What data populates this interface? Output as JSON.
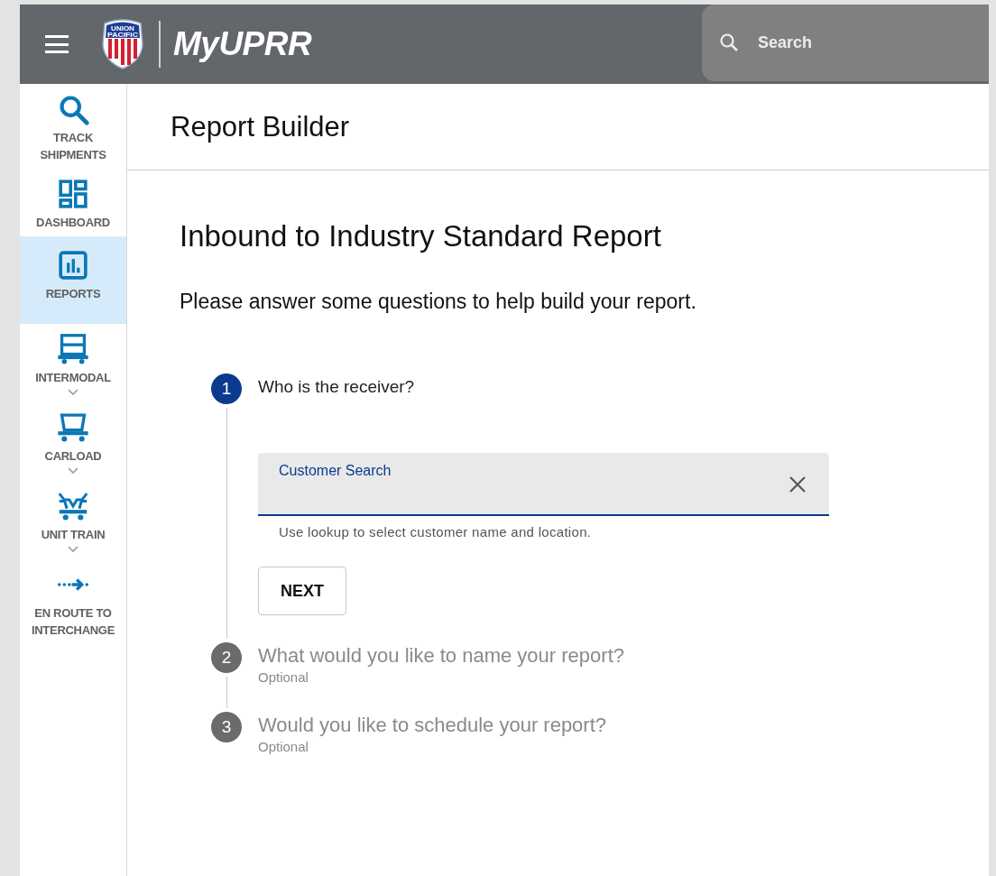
{
  "header": {
    "logo_text": [
      "UNION",
      "PACIFIC"
    ],
    "brand": "MyUPRR",
    "search": {
      "placeholder": "Search"
    }
  },
  "sidebar": {
    "items": [
      {
        "kind": "search",
        "label": "TRACK SHIPMENTS",
        "selected": false,
        "expandable": false
      },
      {
        "kind": "dashboard",
        "label": "DASHBOARD",
        "selected": false,
        "expandable": false
      },
      {
        "kind": "reports",
        "label": "REPORTS",
        "selected": true,
        "expandable": false
      },
      {
        "kind": "intermodal",
        "label": "INTERMODAL",
        "selected": false,
        "expandable": true
      },
      {
        "kind": "carload",
        "label": "CARLOAD",
        "selected": false,
        "expandable": true
      },
      {
        "kind": "unit-train",
        "label": "UNIT TRAIN",
        "selected": false,
        "expandable": true
      },
      {
        "kind": "en-route",
        "label": "EN ROUTE TO INTERCHANGE",
        "selected": false,
        "expandable": false
      }
    ]
  },
  "page_title": "Report Builder",
  "report_title": "Inbound to Industry Standard Report",
  "intro": "Please answer some questions to help build your report.",
  "steps": [
    {
      "number": "1",
      "title": "Who is the receiver?",
      "selected": true,
      "field": {
        "label": "Customer Search",
        "hint": "Use lookup to select customer name and location."
      },
      "button": "NEXT"
    },
    {
      "number": "2",
      "title": "What would you like to name your report?",
      "subtitle": "Optional",
      "selected": false
    },
    {
      "number": "3",
      "title": "Would you like to schedule your report?",
      "subtitle": "Optional",
      "selected": false
    }
  ]
}
